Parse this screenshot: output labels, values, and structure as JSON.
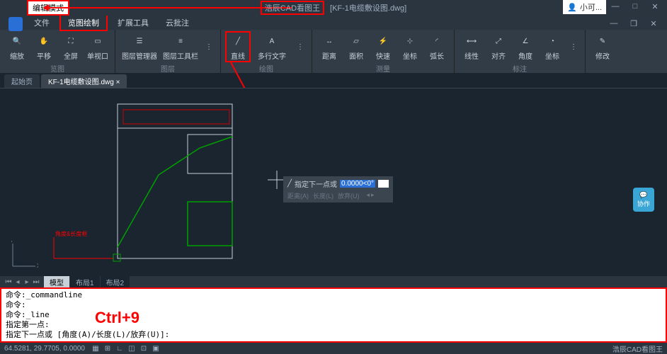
{
  "titlebar": {
    "mode": "编辑模式",
    "app": "浩辰CAD看图王",
    "filename": "[KF-1电缆敷设图.dwg]",
    "user": "小可..."
  },
  "menu": {
    "file": "文件",
    "viewdraw": "览图绘制",
    "exttools": "扩展工具",
    "cloud": "云批注"
  },
  "ribbon": {
    "zoom": "缩放",
    "pan": "平移",
    "full": "全屏",
    "single": "单视口",
    "layermgr": "图层管理器",
    "layertool": "图层工具栏",
    "line": "直线",
    "mtext": "多行文字",
    "dist": "距离",
    "area": "面积",
    "fast": "快速",
    "coord": "坐标",
    "arc": "弧长",
    "linear": "线性",
    "align": "对齐",
    "angle": "角度",
    "radius": "坐标",
    "modify": "修改",
    "g_view": "览图",
    "g_layer": "图层",
    "g_draw": "绘图",
    "g_measure": "测量",
    "g_annot": "标注"
  },
  "tabs": {
    "start": "起始页",
    "doc": "KF-1电缆敷设图.dwg"
  },
  "overlay": {
    "prompt": "指定下一点或",
    "value": "0.0000<0°",
    "opt1": "距离(A)",
    "opt2": "长度(L)",
    "opt3": "放弃(U)"
  },
  "chat": "协作",
  "layout": {
    "model": "模型",
    "l1": "布局1",
    "l2": "布局2"
  },
  "cmd": {
    "l1": "命令:_commandline",
    "l2": "命令:",
    "l3": "命令:_line",
    "l4": "指定第一点:",
    "l5": "指定下一点或 [角度(A)/长度(L)/放弃(U)]:"
  },
  "annotation": "Ctrl+9",
  "status": {
    "coords": "64.5281, 29.7705, 0.0000",
    "brand": "浩辰CAD看图王"
  }
}
